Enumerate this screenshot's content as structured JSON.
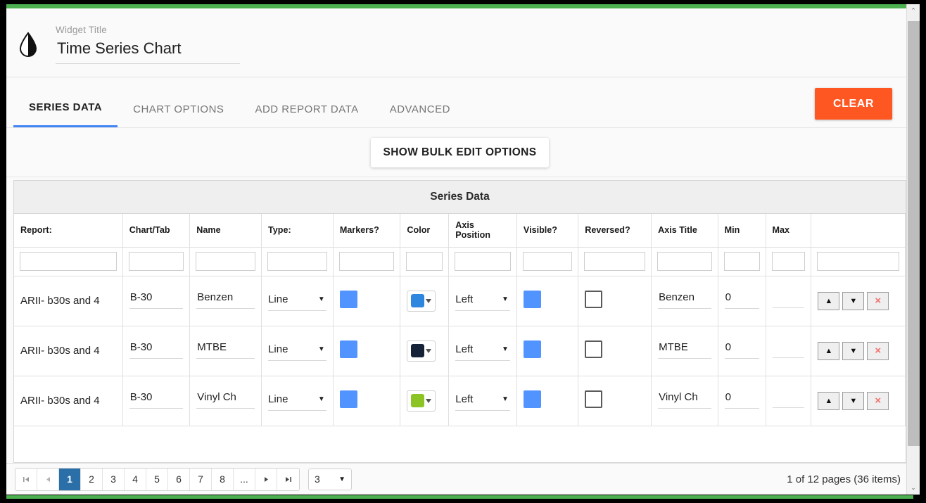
{
  "theme": {
    "accent_green": "#4CAF50",
    "clear_orange": "#FF5722",
    "tab_blue": "#4285f4",
    "page_active_blue": "#2A6FA8",
    "checkbox_blue": "#5294FF"
  },
  "header": {
    "icon": "contrast-droplet-icon",
    "widget_title_label": "Widget Title",
    "widget_title_value": "Time Series Chart",
    "widget_title_placeholder": "Widget Title"
  },
  "tabs": [
    {
      "label": "SERIES DATA",
      "active": true
    },
    {
      "label": "CHART OPTIONS",
      "active": false
    },
    {
      "label": "ADD REPORT DATA",
      "active": false
    },
    {
      "label": "ADVANCED",
      "active": false
    }
  ],
  "toolbar": {
    "clear_label": "CLEAR",
    "bulk_edit_label": "SHOW BULK EDIT OPTIONS"
  },
  "grid": {
    "title": "Series Data",
    "columns": [
      "Report:",
      "Chart/Tab",
      "Name",
      "Type:",
      "Markers?",
      "Color",
      "Axis Position",
      "Visible?",
      "Reversed?",
      "Axis Title",
      "Min",
      "Max",
      ""
    ],
    "filter_placeholder": "",
    "rows": [
      {
        "report": "ARII- b30s and 4",
        "chart_tab": "B-30",
        "name": "Benzen",
        "type": "Line",
        "markers": true,
        "color": "#2E86DE",
        "axis_position": "Left",
        "visible": true,
        "reversed": false,
        "axis_title": "Benzen",
        "min": "0",
        "max": "",
        "actions": {
          "up": "▲",
          "down": "▼",
          "delete": "×"
        }
      },
      {
        "report": "ARII- b30s and 4",
        "chart_tab": "B-30",
        "name": "MTBE",
        "type": "Line",
        "markers": true,
        "color": "#152238",
        "axis_position": "Left",
        "visible": true,
        "reversed": false,
        "axis_title": "MTBE",
        "min": "0",
        "max": "",
        "actions": {
          "up": "▲",
          "down": "▼",
          "delete": "×"
        }
      },
      {
        "report": "ARII- b30s and 4",
        "chart_tab": "B-30",
        "name": "Vinyl Ch",
        "type": "Line",
        "markers": true,
        "color": "#8CC425",
        "axis_position": "Left",
        "visible": true,
        "reversed": false,
        "axis_title": "Vinyl Ch",
        "min": "0",
        "max": "",
        "actions": {
          "up": "▲",
          "down": "▼",
          "delete": "×"
        }
      }
    ]
  },
  "pager": {
    "first": "⏮",
    "prev": "◀",
    "next": "▶",
    "last": "⏭",
    "pages": [
      "1",
      "2",
      "3",
      "4",
      "5",
      "6",
      "7",
      "8"
    ],
    "ellipsis": "...",
    "active_page": "1",
    "page_size": "3",
    "status": "1 of 12 pages (36 items)"
  },
  "scrollbar": {
    "up": "⌃",
    "down": "⌄"
  }
}
